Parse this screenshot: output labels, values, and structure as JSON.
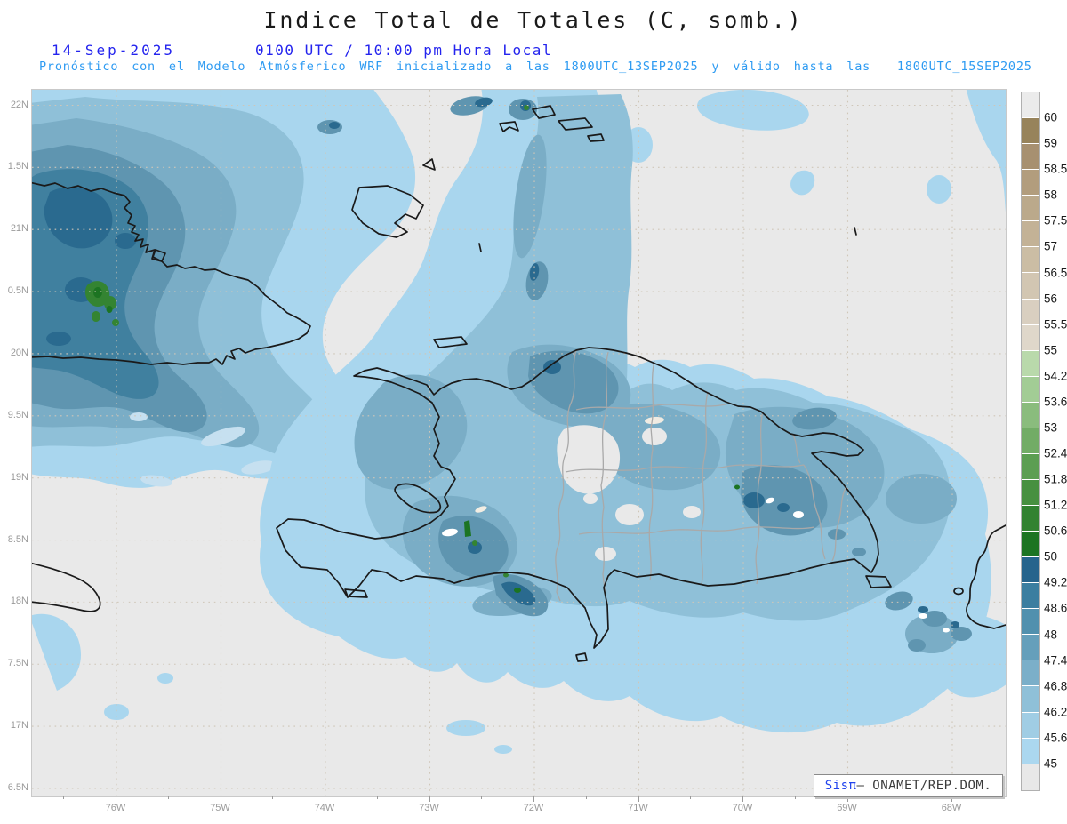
{
  "header": {
    "title": "Indice Total de Totales (C, somb.)",
    "date": "14-Sep-2025",
    "time_line": "0100 UTC / 10:00 pm Hora Local",
    "forecast_line": "Pronóstico con el Modelo Atmósferico WRF inicializado a las 1800UTC_13SEP2025 y válido hasta las  1800UTC_15SEP2025"
  },
  "colors": {
    "title_text": "#1a1a1a",
    "date_line_text": "#2424ee",
    "forecast_line_text": "#2e9bf2",
    "axis_label_text": "#9a9a9a",
    "map_background": "#e9e9e9",
    "gridline": "#cfc6b8",
    "coastline": "#1a1a1a",
    "province_border": "#a9a9a9"
  },
  "map": {
    "lat_labels": [
      "22N",
      "1.5N",
      "21N",
      "0.5N",
      "20N",
      "9.5N",
      "19N",
      "8.5N",
      "18N",
      "7.5N",
      "17N",
      "6.5N"
    ],
    "lon_labels": [
      "76W",
      "75W",
      "74W",
      "73W",
      "72W",
      "71W",
      "70W",
      "69W",
      "68W"
    ]
  },
  "colorbar": {
    "tick_labels": [
      "60",
      "59",
      "58.5",
      "58",
      "57.5",
      "57",
      "56.5",
      "56",
      "55.5",
      "55",
      "54.2",
      "53.6",
      "53",
      "52.4",
      "51.8",
      "51.2",
      "50.6",
      "50",
      "49.2",
      "48.6",
      "48",
      "47.4",
      "46.8",
      "46.2",
      "45.6",
      "45"
    ],
    "segment_colors": [
      "#ebebeb",
      "#97835b",
      "#a79070",
      "#b29d7d",
      "#bba98b",
      "#c3b296",
      "#cbbda4",
      "#d2c6b2",
      "#d9cfc0",
      "#dfd7ca",
      "#b9d9ab",
      "#a2cc95",
      "#8abc7d",
      "#72ac66",
      "#5c9e52",
      "#479040",
      "#328231",
      "#1c7422",
      "#26648c",
      "#3b7ea0",
      "#5190ae",
      "#659fbb",
      "#7bafc9",
      "#8fc0d8",
      "#a0cde4",
      "#abd7ef",
      "#e8e8e8"
    ]
  },
  "attribution": {
    "brand": "Sisπ",
    "text": " – ONAMET/REP.DOM."
  },
  "chart_data": {
    "type": "heatmap",
    "title": "Indice Total de Totales (C, somb.)",
    "subtitle": "14-Sep-2025 0100 UTC / 10:00 pm Hora Local",
    "units": "C",
    "x_axis": {
      "label": "longitude",
      "tick_labels": [
        "76W",
        "75W",
        "74W",
        "73W",
        "72W",
        "71W",
        "70W",
        "69W",
        "68W"
      ],
      "range_deg_west": [
        76.8,
        67.5
      ]
    },
    "y_axis": {
      "label": "latitude",
      "tick_labels": [
        "22N",
        "1.5N",
        "21N",
        "0.5N",
        "20N",
        "9.5N",
        "19N",
        "8.5N",
        "18N",
        "7.5N",
        "17N",
        "6.5N"
      ],
      "range_deg_north": [
        16.4,
        22.1
      ]
    },
    "legend_levels": [
      45,
      45.6,
      46.2,
      46.8,
      47.4,
      48,
      48.6,
      49.2,
      50,
      50.6,
      51.2,
      51.8,
      52.4,
      53,
      53.6,
      54.2,
      55,
      55.5,
      56,
      56.5,
      57,
      57.5,
      58,
      58.5,
      59,
      60
    ],
    "legend_position": "right",
    "grid": true,
    "notable_features": [
      {
        "region": "eastern Cuba (northwest of map)",
        "value_range": "47-51, small cores above 50 (green spots)"
      },
      {
        "region": "Hispaniola and Atlantic east of it",
        "value_range": "45-50, scattered dark cores near 49-50 and isolated green >50 spots"
      },
      {
        "region": "northeast quadrant and southern Caribbean",
        "value_range": "below 45 (gray background)"
      }
    ]
  }
}
